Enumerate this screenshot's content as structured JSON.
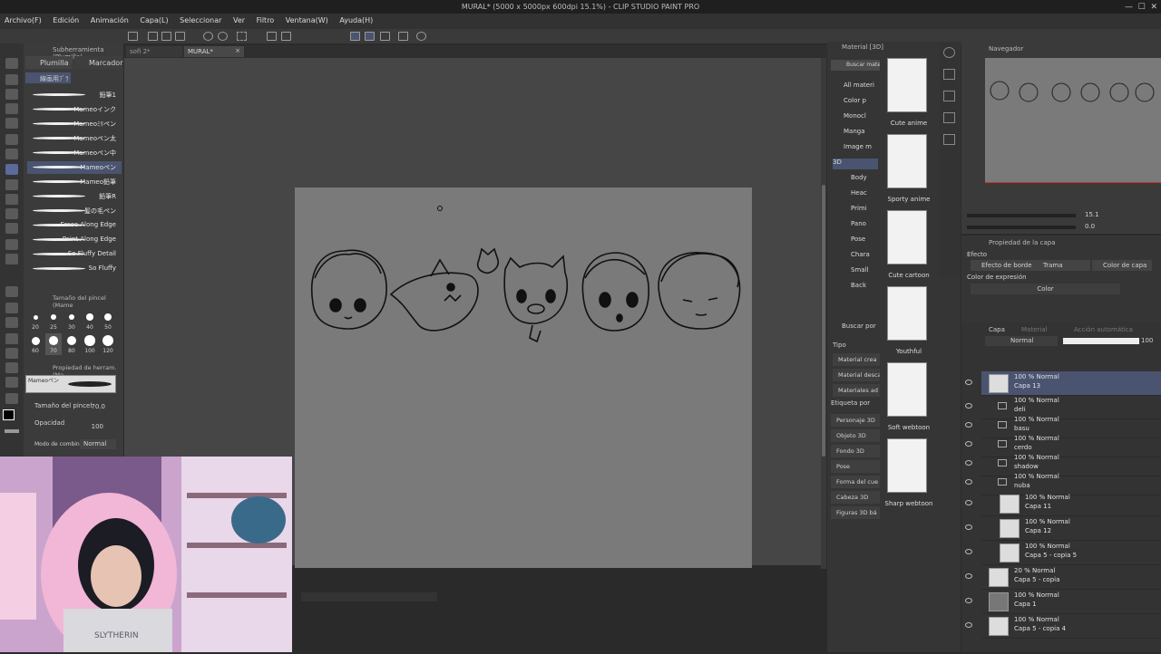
{
  "window": {
    "title": "MURAL* (5000 x 5000px 600dpi 15.1%) - CLIP STUDIO PAINT PRO"
  },
  "menu": [
    "Archivo(F)",
    "Edición",
    "Animación",
    "Capa(L)",
    "Seleccionar",
    "Ver",
    "Filtro",
    "Ventana(W)",
    "Ayuda(H)"
  ],
  "doc_tabs": [
    "sofi 2*",
    "MURAL*"
  ],
  "subtool": {
    "header": "Subherramienta (Plumilla)",
    "tabs": [
      "Plumilla",
      "Marcador"
    ],
    "group": "線画用ﾌﾞﾗ",
    "brushes": [
      "鉛筆1",
      "Mameoインク",
      "Mameoﾐﾘペン",
      "Mameoペン太",
      "Mameoペン中",
      "Mameoペン",
      "Mameo鉛筆",
      "鉛筆R",
      "髪の毛ペン",
      "Erase Along Edge",
      "Paint Along Edge",
      "So Fluffy Detail",
      "So Fluffy"
    ],
    "selected_index": 5
  },
  "brush_size": {
    "header": "Tamaño del pincel (Mame",
    "sizes": [
      "20",
      "25",
      "30",
      "40",
      "50",
      "60",
      "70",
      "80",
      "100",
      "120"
    ],
    "selected": "70"
  },
  "tool_props": {
    "header": "Propiedad de herram. (Ma",
    "preset": "Mameoペン",
    "brush_size_label": "Tamaño del pincel",
    "brush_size_value": "70.0",
    "opacity_label": "Opacidad",
    "opacity_value": "100",
    "blend_label": "Modo de combinac",
    "blend_value": "Normal"
  },
  "material": {
    "header": "Material [3D]",
    "search_btn": "Buscar material",
    "tree": [
      "All materi",
      "Color p",
      "Monocl",
      "Manga",
      "Image m",
      "3D",
      "Body",
      "Heac",
      "Primi",
      "Pano",
      "Pose",
      "Chara",
      "Small",
      "Back"
    ],
    "tree_selected": "3D",
    "thumbs": [
      "Cute anime",
      "Sporty anime",
      "Cute cartoon",
      "Youthful",
      "Soft webtoon",
      "Sharp webtoon"
    ],
    "search_label": "Buscar por",
    "tipo_label": "Tipo",
    "tipo_items": [
      "Material crea",
      "Material desca",
      "Materiales ad"
    ],
    "etiqueta_label": "Etiqueta por",
    "tags": [
      "Personaje 3D",
      "Objeto 3D",
      "Fondo 3D",
      "Pose",
      "Forma del cue",
      "Cabeza 3D",
      "Figuras 3D bá"
    ]
  },
  "navigator": {
    "header": "Navegador",
    "zoom": "15.1",
    "angle": "0.0"
  },
  "layer_props": {
    "header": "Propiedad de la capa",
    "effect_label": "Efecto",
    "effects": [
      "Efecto de borde",
      "Trama",
      "Color de capa"
    ],
    "expression_label": "Color de expresión",
    "expression_value": "Color"
  },
  "layers": {
    "tabs": [
      "Capa",
      "Material",
      "Acción automática"
    ],
    "blend": "Normal",
    "opacity": "100",
    "rows": [
      {
        "mode": "100 % Normal",
        "name": "Capa 13",
        "type": "layer",
        "indent": 0,
        "selected": true
      },
      {
        "mode": "100 % Normal",
        "name": "deli",
        "type": "folder",
        "indent": 0
      },
      {
        "mode": "100 % Normal",
        "name": "basu",
        "type": "folder",
        "indent": 0
      },
      {
        "mode": "100 % Normal",
        "name": "cerdo",
        "type": "folder",
        "indent": 0
      },
      {
        "mode": "100 % Normal",
        "name": "shadow",
        "type": "folder",
        "indent": 0
      },
      {
        "mode": "100 % Normal",
        "name": "nuba",
        "type": "folder-open",
        "indent": 0
      },
      {
        "mode": "100 % Normal",
        "name": "Capa 11",
        "type": "layer",
        "indent": 1
      },
      {
        "mode": "100 % Normal",
        "name": "Capa 12",
        "type": "layer",
        "indent": 1
      },
      {
        "mode": "100 % Normal",
        "name": "Capa 5 - copia 5",
        "type": "layer",
        "indent": 1
      },
      {
        "mode": "20 % Normal",
        "name": "Capa 5 - copia",
        "type": "layer",
        "indent": 0
      },
      {
        "mode": "100 % Normal",
        "name": "Capa 1",
        "type": "layer-gray",
        "indent": 0
      },
      {
        "mode": "100 % Normal",
        "name": "Capa 5 - copia 4",
        "type": "layer",
        "indent": 0
      }
    ]
  },
  "webcam": {
    "shirt_text": "SLYTHERIN"
  },
  "colors": {
    "accent": "#4a5470",
    "canvas": "#7a7a7a",
    "bg": "#464646"
  }
}
